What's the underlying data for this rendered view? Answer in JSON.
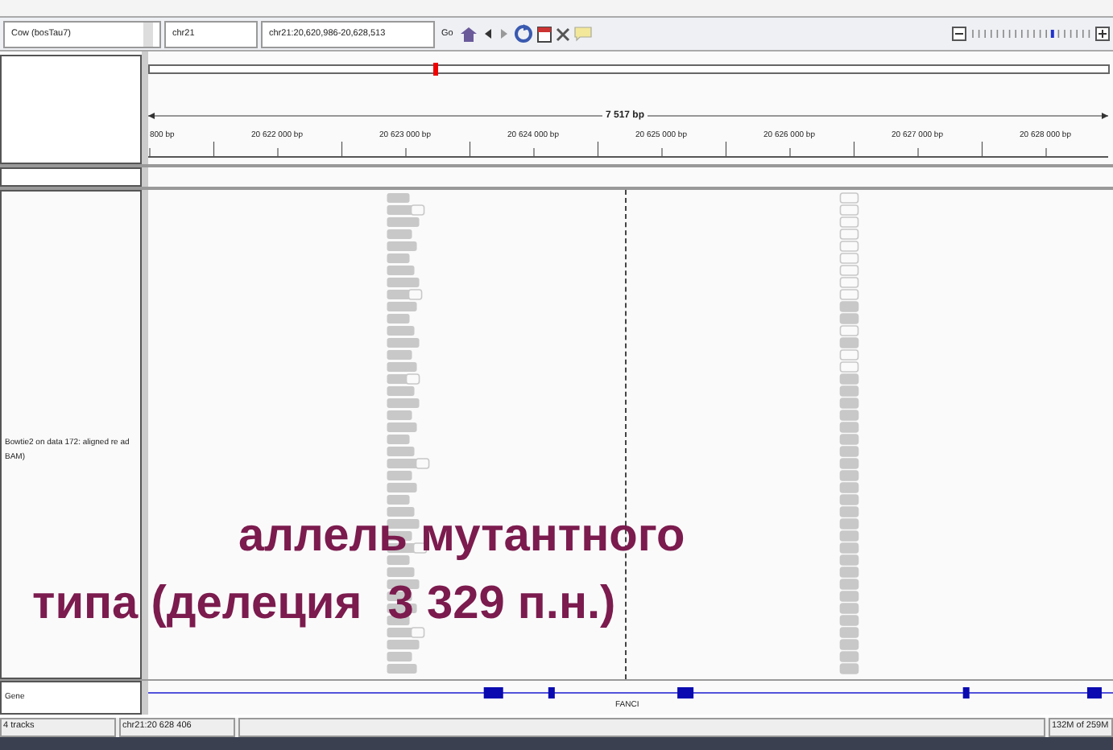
{
  "toolbar": {
    "genome": "Cow (bosTau7)",
    "chromosome": "chr21",
    "locus": "chr21:20,620,986-20,628,513",
    "go": "Go"
  },
  "ruler": {
    "span": "7 517 bp",
    "ticks": [
      "800 bp",
      "20 622 000 bp",
      "20 623 000 bp",
      "20 624 000 bp",
      "20 625 000 bp",
      "20 626 000 bp",
      "20 627 000 bp",
      "20 628 000 bp"
    ]
  },
  "tracks": [
    {
      "kind": "alignment",
      "name": "Bowtie2 on data 172: aligned re ad BAM)"
    },
    {
      "kind": "gene",
      "name": "Gene",
      "gene": "FANCI"
    }
  ],
  "status_bar": {
    "tracks": "4 tracks",
    "position": "chr21:20 628 406",
    "memory": "132M of 259M"
  },
  "overlay": {
    "line_1": "аллель мутантного",
    "line_2": "типа (делеция  3 329 п.н.)"
  }
}
